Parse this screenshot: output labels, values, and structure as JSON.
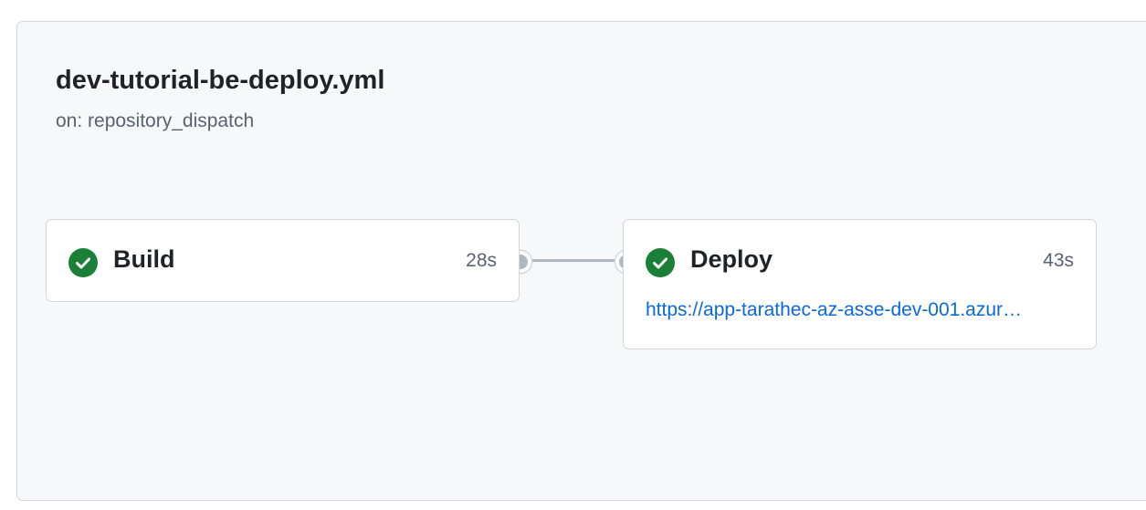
{
  "workflow": {
    "title": "dev-tutorial-be-deploy.yml",
    "trigger": "on: repository_dispatch"
  },
  "jobs": [
    {
      "name": "Build",
      "duration": "28s",
      "status": "success",
      "status_icon": "check-circle-fill-icon",
      "status_color": "#1a7f37"
    },
    {
      "name": "Deploy",
      "duration": "43s",
      "status": "success",
      "status_icon": "check-circle-fill-icon",
      "status_color": "#1a7f37",
      "environment_url": "https://app-tarathec-az-asse-dev-001.azur…"
    }
  ],
  "colors": {
    "panel_bg": "#f6f8fa",
    "border": "#d0d7de",
    "link": "#0969da",
    "connector": "#afb8c1"
  }
}
